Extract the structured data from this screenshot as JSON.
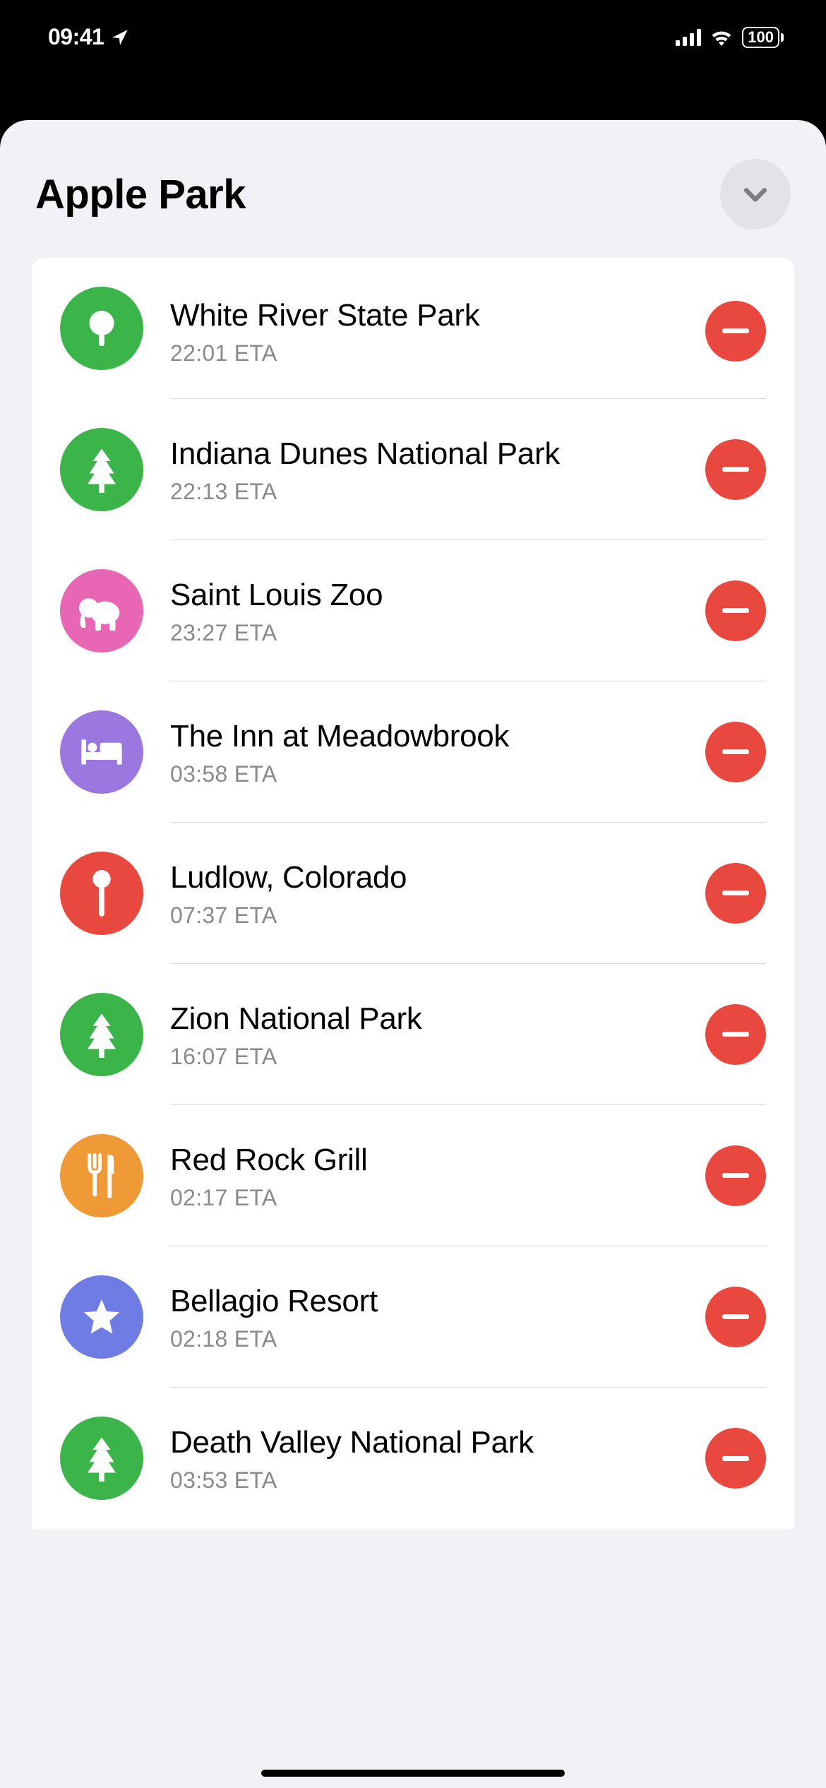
{
  "status": {
    "time": "09:41",
    "battery": "100"
  },
  "header": {
    "title": "Apple Park"
  },
  "places": [
    {
      "name": "White River State Park",
      "eta": "22:01 ETA",
      "icon": "tree-round",
      "color": "green"
    },
    {
      "name": "Indiana Dunes National Park",
      "eta": "22:13 ETA",
      "icon": "pine",
      "color": "green"
    },
    {
      "name": "Saint Louis Zoo",
      "eta": "23:27 ETA",
      "icon": "elephant",
      "color": "pink"
    },
    {
      "name": "The Inn at Meadowbrook",
      "eta": "03:58 ETA",
      "icon": "bed",
      "color": "purple"
    },
    {
      "name": "Ludlow, Colorado",
      "eta": "07:37 ETA",
      "icon": "pin",
      "color": "red"
    },
    {
      "name": "Zion National Park",
      "eta": "16:07 ETA",
      "icon": "pine",
      "color": "green"
    },
    {
      "name": "Red Rock Grill",
      "eta": "02:17 ETA",
      "icon": "fork-knife",
      "color": "orange"
    },
    {
      "name": "Bellagio Resort",
      "eta": "02:18 ETA",
      "icon": "star",
      "color": "blue"
    },
    {
      "name": "Death Valley National Park",
      "eta": "03:53 ETA",
      "icon": "pine",
      "color": "green"
    }
  ]
}
